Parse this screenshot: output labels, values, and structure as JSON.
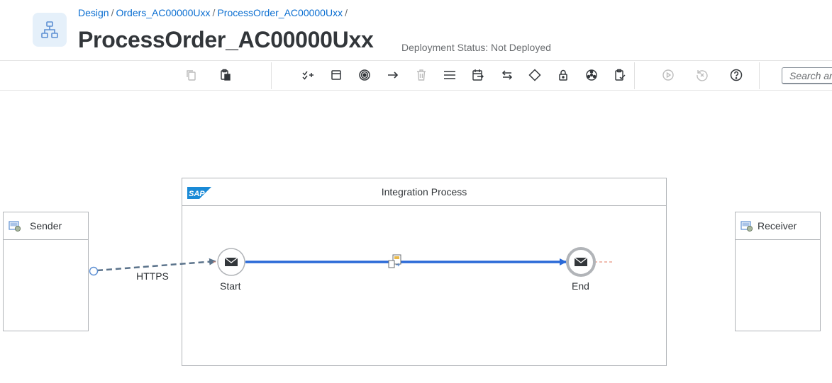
{
  "breadcrumb": {
    "items": [
      "Design",
      "Orders_AC00000Uxx",
      "ProcessOrder_AC00000Uxx"
    ],
    "separator": "/"
  },
  "header": {
    "title": "ProcessOrder_AC00000Uxx",
    "deployment_status": "Deployment Status: Not Deployed"
  },
  "toolbar": {
    "search_placeholder": "Search an",
    "icons": [
      "copy-icon",
      "paste-icon",
      "validate-icon",
      "participant-icon",
      "events-icon",
      "connector-icon",
      "delete-icon",
      "menu-icon",
      "call-icon",
      "mapping-icon",
      "routing-icon",
      "security-icon",
      "process-icon",
      "validate-check-icon",
      "simulate-icon",
      "reset-icon",
      "help-icon"
    ]
  },
  "canvas": {
    "integration_process": {
      "title": "Integration Process",
      "logo": "SAP"
    },
    "sender": {
      "label": "Sender"
    },
    "receiver": {
      "label": "Receiver"
    },
    "channel": {
      "label": "HTTPS"
    },
    "start_event": {
      "label": "Start"
    },
    "end_event": {
      "label": "End"
    }
  },
  "colors": {
    "link": "#0a6ed1",
    "flow": "#2a69d7",
    "channel": "#5b738b",
    "border": "#b1b4b8"
  }
}
